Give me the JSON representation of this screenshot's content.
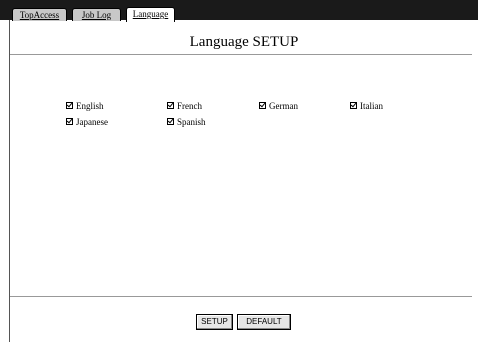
{
  "tabs": [
    {
      "label": "TopAccess",
      "active": false
    },
    {
      "label": "Job Log",
      "active": false
    },
    {
      "label": "Language",
      "active": true
    }
  ],
  "page": {
    "title": "Language SETUP"
  },
  "languages": [
    {
      "label": "English",
      "checked": true
    },
    {
      "label": "French",
      "checked": true
    },
    {
      "label": "German",
      "checked": true
    },
    {
      "label": "Italian",
      "checked": true
    },
    {
      "label": "Japanese",
      "checked": true
    },
    {
      "label": "Spanish",
      "checked": true
    }
  ],
  "buttons": {
    "setup": "SETUP",
    "default": "DEFAULT"
  }
}
